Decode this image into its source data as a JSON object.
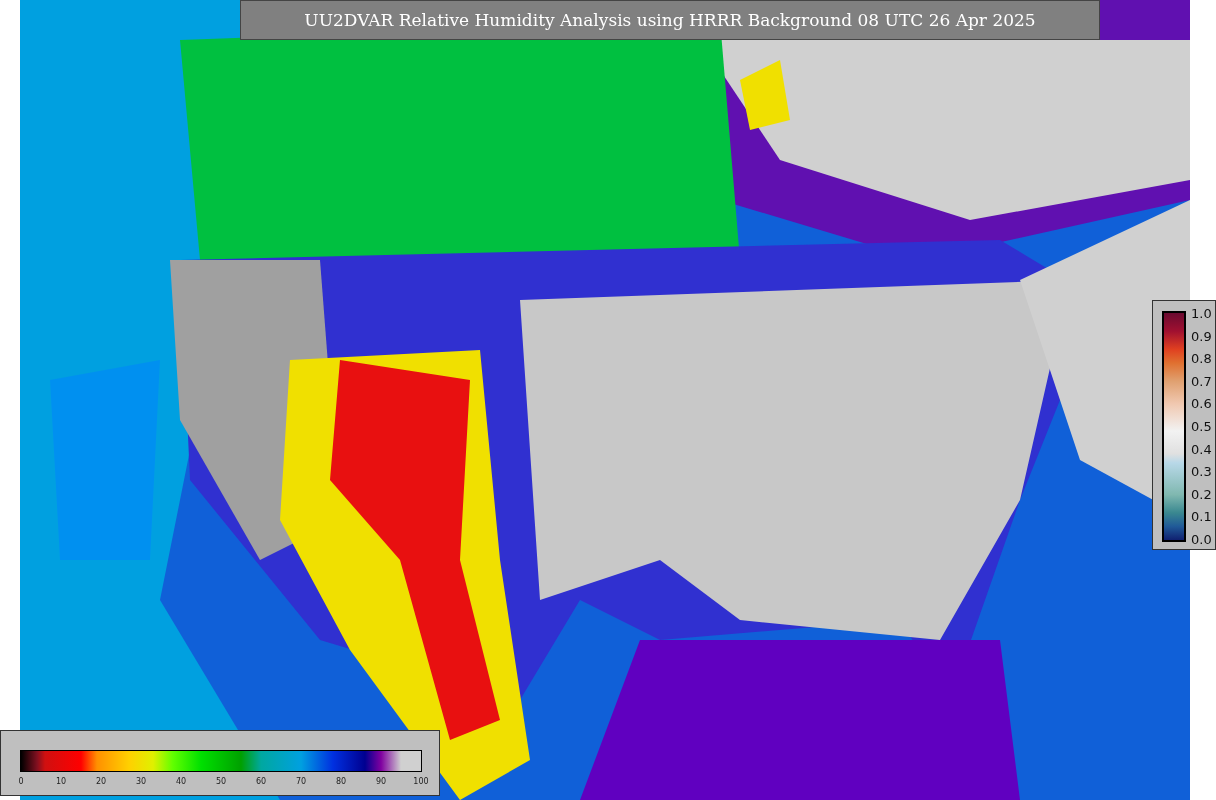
{
  "title": "UU2DVAR Relative Humidity Analysis using HRRR Background 08 UTC 26 Apr 2025",
  "side_colorbar": {
    "ticks": [
      "1.0",
      "0.9",
      "0.8",
      "0.7",
      "0.6",
      "0.5",
      "0.4",
      "0.3",
      "0.2",
      "0.1",
      "0.0"
    ]
  },
  "bottom_colorbar": {
    "ticks": [
      "0",
      "10",
      "20",
      "30",
      "40",
      "50",
      "60",
      "70",
      "80",
      "90",
      "100"
    ]
  }
}
